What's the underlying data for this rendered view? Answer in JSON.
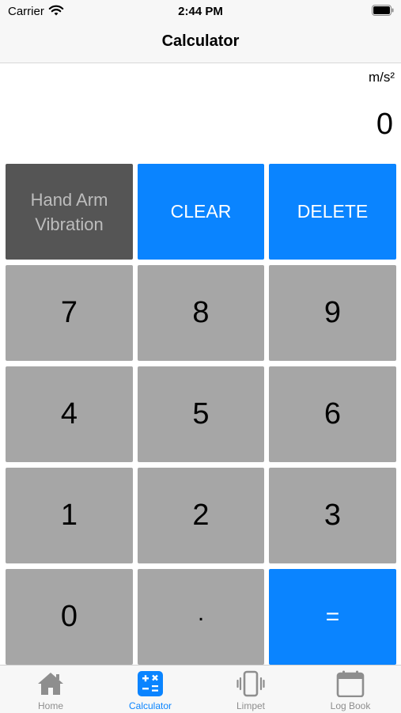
{
  "status_bar": {
    "carrier": "Carrier",
    "time": "2:44 PM"
  },
  "nav": {
    "title": "Calculator"
  },
  "display": {
    "unit": "m/s²",
    "value": "0"
  },
  "keypad": {
    "mode": {
      "line1": "Hand Arm",
      "line2": "Vibration"
    },
    "clear": "CLEAR",
    "delete": "DELETE",
    "k7": "7",
    "k8": "8",
    "k9": "9",
    "k4": "4",
    "k5": "5",
    "k6": "6",
    "k1": "1",
    "k2": "2",
    "k3": "3",
    "k0": "0",
    "dot": ".",
    "equals": "="
  },
  "tabs": [
    {
      "label": "Home",
      "icon": "home-icon",
      "active": false
    },
    {
      "label": "Calculator",
      "icon": "calculator-icon",
      "active": true
    },
    {
      "label": "Limpet",
      "icon": "vibrating-phone-icon",
      "active": false
    },
    {
      "label": "Log Book",
      "icon": "calendar-icon",
      "active": false
    }
  ],
  "colors": {
    "accent_blue": "#0a84ff",
    "key_gray": "#a6a6a6",
    "mode_dark": "#555555",
    "tab_inactive": "#8e8e8e"
  }
}
